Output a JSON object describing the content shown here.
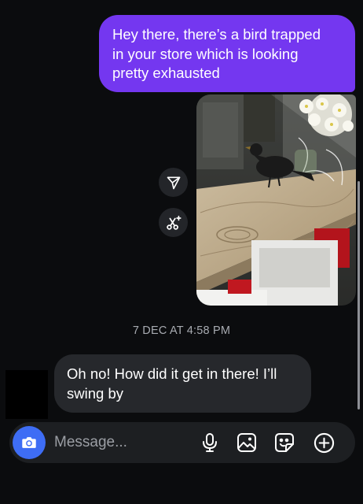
{
  "thread": {
    "outgoing": {
      "lines": [
        "Hey there, there’s a bird trapped",
        "in your store which is looking",
        "pretty exhausted"
      ]
    },
    "photo": {
      "description_icon": "bird-photo"
    },
    "side_actions": [
      {
        "icon": "paper-plane-icon"
      },
      {
        "icon": "magic-edit-icon"
      }
    ],
    "timestamp": "7 DEC AT 4:58 PM",
    "incoming": {
      "lines": [
        "Oh no! How did it get in there! I’ll",
        "swing by"
      ]
    }
  },
  "composer": {
    "placeholder": "Message...",
    "icons": [
      "camera-icon",
      "microphone-icon",
      "gallery-icon",
      "sticker-icon",
      "add-icon"
    ]
  },
  "colors": {
    "background": "#0b0c0e",
    "outgoing_bubble": "#7437f0",
    "incoming_bubble": "#26282c",
    "camera_button": "#3e6df5",
    "timestamp_text": "#a8abb1"
  }
}
